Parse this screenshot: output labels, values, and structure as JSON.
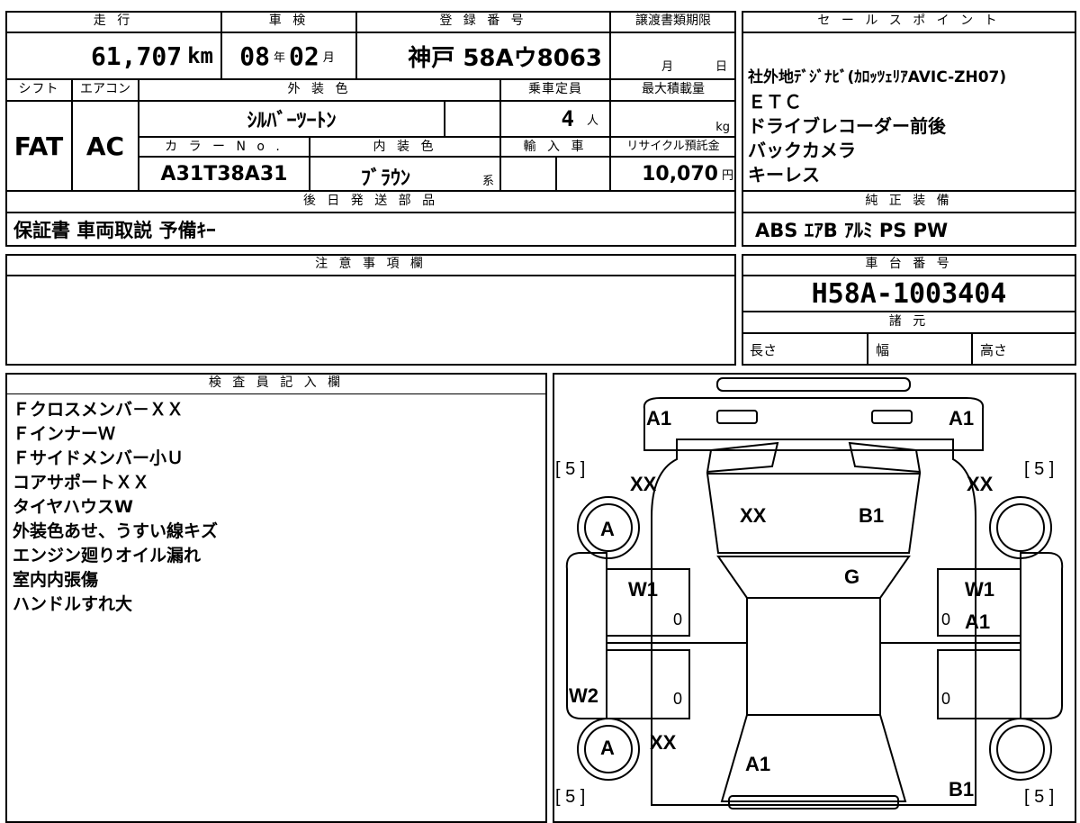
{
  "top_left": {
    "headers": {
      "mileage": "走 行",
      "shaken": "車 検",
      "registration": "登 録 番 号",
      "transfer_deadline": "譲渡書類期限",
      "shift": "シフト",
      "aircon": "エアコン",
      "exterior_color": "外 装 色",
      "capacity": "乗車定員",
      "max_load": "最大積載量",
      "color_no": "カ ラ ー N o .",
      "interior_color": "内 装 色",
      "import": "輸 入 車",
      "recycle": "リサイクル預託金",
      "later_parts": "後 日 発 送 部 品"
    },
    "mileage_value": "61,707",
    "mileage_unit": "km",
    "shaken_year": "08",
    "shaken_year_unit": "年",
    "shaken_month": "02",
    "shaken_month_unit": "月",
    "registration_value": "神戸 58Aウ8063",
    "transfer_month_unit": "月",
    "transfer_day_unit": "日",
    "shift_value": "FAT",
    "aircon_value": "AC",
    "exterior_color_value": "ｼﾙﾊﾞｰﾂｰﾄﾝ",
    "capacity_value": "4",
    "capacity_unit": "人",
    "max_load_unit": "kg",
    "color_no_value": "A31T38A31",
    "interior_color_value": "ﾌﾞﾗｳﾝ",
    "interior_color_suffix": "系",
    "recycle_value": "10,070",
    "recycle_unit": "円",
    "later_parts_value": "保証書 車両取説 予備ｷｰ"
  },
  "sales_points": {
    "header": "セ ー ル ス ポ イ ン ト",
    "lines": [
      "社外地ﾃﾞｼﾞﾅﾋﾞ(ｶﾛｯﾂｪﾘｱAVIC-ZH07)",
      "ＥＴＣ",
      "ドライブレコーダー前後",
      "バックカメラ",
      "キーレス"
    ]
  },
  "standard_equipment": {
    "header": "純 正 装 備",
    "value": "ABS ｴｱB ｱﾙﾐ PS PW"
  },
  "caution": {
    "header": "注 意 事 項 欄"
  },
  "chassis": {
    "header": "車 台 番 号",
    "value": "H58A-1003404",
    "specs_header": "諸 元",
    "length_label": "長さ",
    "width_label": "幅",
    "height_label": "高さ"
  },
  "inspector": {
    "header": "検 査 員 記 入 欄",
    "lines": [
      "Ｆクロスメンバ－ＸＸ",
      "ＦインナーＷ",
      "Ｆサイドメンバー小Ｕ",
      "コアサポートＸＸ",
      "タイヤハウスW",
      "外装色あせ、うすい線キズ",
      "エンジン廻りオイル漏れ",
      "室内内張傷",
      "ハンドルすれ大"
    ]
  },
  "car_map": {
    "labels": {
      "front_left": "A1",
      "front_right": "A1",
      "tire_fl": "[ 5 ]",
      "tire_fr": "[ 5 ]",
      "tire_rl": "[ 5 ]",
      "tire_rr": "[ 5 ]",
      "fender_fl": "XX",
      "fender_fr": "XX",
      "hood_left": "XX",
      "hood_right": "B1",
      "wheel_fl": "A",
      "wheel_rl": "A",
      "windshield": "G",
      "door_fl": "W1",
      "door_fr": "W1",
      "door_fr2": "A1",
      "door_rl": "W2",
      "fender_rl": "XX",
      "trunk": "A1",
      "rear_right": "B1",
      "zero_1": "0",
      "zero_2": "0",
      "zero_3": "0",
      "zero_4": "0"
    }
  }
}
